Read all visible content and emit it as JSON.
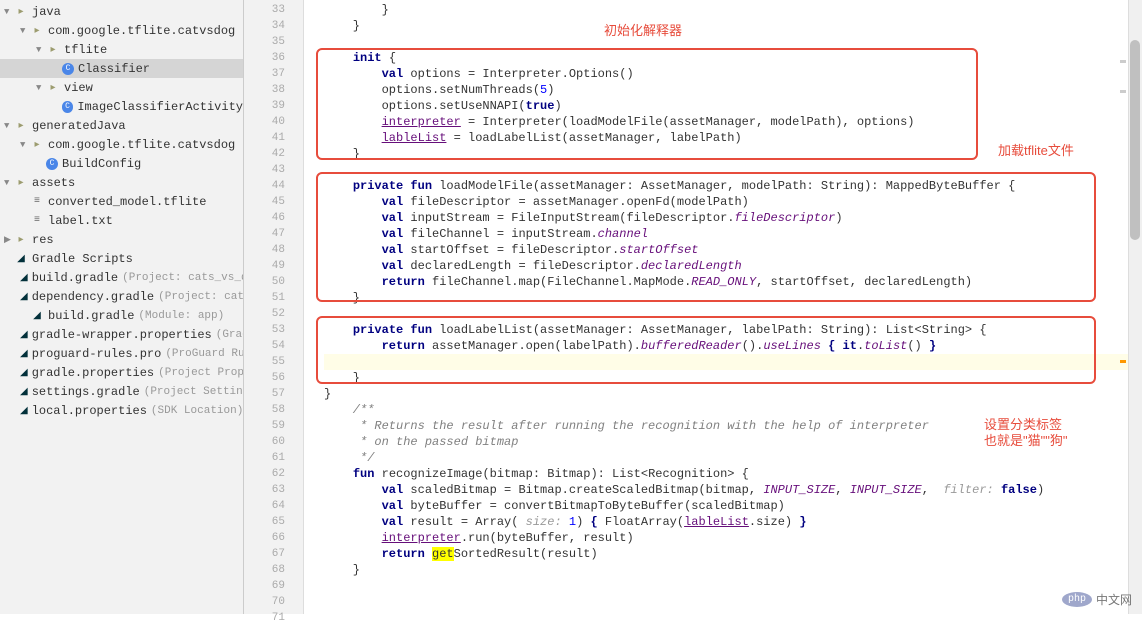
{
  "tree": [
    {
      "indent": 0,
      "arrow": "▼",
      "icon": "folder",
      "label": "java"
    },
    {
      "indent": 1,
      "arrow": "▼",
      "icon": "folder",
      "label": "com.google.tflite.catvsdog"
    },
    {
      "indent": 2,
      "arrow": "▼",
      "icon": "folder",
      "label": "tflite"
    },
    {
      "indent": 3,
      "arrow": "",
      "icon": "class",
      "label": "Classifier",
      "selected": true
    },
    {
      "indent": 2,
      "arrow": "▼",
      "icon": "folder",
      "label": "view"
    },
    {
      "indent": 3,
      "arrow": "",
      "icon": "class",
      "label": "ImageClassifierActivity"
    },
    {
      "indent": 0,
      "arrow": "▼",
      "icon": "folder",
      "label": "generatedJava"
    },
    {
      "indent": 1,
      "arrow": "▼",
      "icon": "folder",
      "label": "com.google.tflite.catvsdog"
    },
    {
      "indent": 2,
      "arrow": "",
      "icon": "class",
      "label": "BuildConfig"
    },
    {
      "indent": 0,
      "arrow": "▼",
      "icon": "folder",
      "label": "assets"
    },
    {
      "indent": 1,
      "arrow": "",
      "icon": "txt",
      "label": "converted_model.tflite"
    },
    {
      "indent": 1,
      "arrow": "",
      "icon": "txt",
      "label": "label.txt"
    },
    {
      "indent": 0,
      "arrow": "▶",
      "icon": "folder",
      "label": "res"
    },
    {
      "indent": 0,
      "arrow": "",
      "icon": "gradle",
      "label": "Gradle Scripts",
      "noindent": true
    },
    {
      "indent": 1,
      "arrow": "",
      "icon": "gradle",
      "label": "build.gradle",
      "sub": "(Project: cats_vs_dogs)"
    },
    {
      "indent": 1,
      "arrow": "",
      "icon": "gradle",
      "label": "dependency.gradle",
      "sub": "(Project: cats_vs_..."
    },
    {
      "indent": 1,
      "arrow": "",
      "icon": "gradle",
      "label": "build.gradle",
      "sub": "(Module: app)"
    },
    {
      "indent": 1,
      "arrow": "",
      "icon": "gradle",
      "label": "gradle-wrapper.properties",
      "sub": "(Gradle Ve"
    },
    {
      "indent": 1,
      "arrow": "",
      "icon": "gradle",
      "label": "proguard-rules.pro",
      "sub": "(ProGuard Rules f"
    },
    {
      "indent": 1,
      "arrow": "",
      "icon": "gradle",
      "label": "gradle.properties",
      "sub": "(Project Properties)"
    },
    {
      "indent": 1,
      "arrow": "",
      "icon": "gradle",
      "label": "settings.gradle",
      "sub": "(Project Settings)"
    },
    {
      "indent": 1,
      "arrow": "",
      "icon": "gradle",
      "label": "local.properties",
      "sub": "(SDK Location)"
    }
  ],
  "linestart": 33,
  "lineend": 71,
  "code": {
    "l33": "        }",
    "l34": "    }",
    "l35": "",
    "l37a": "val",
    "l37b": " options = Interpreter.Options()",
    "l38": "        options.setNumThreads(",
    "l38n": "5",
    "l38c": ")",
    "l39a": "        options.setUseNNAPI(",
    "l39b": "true",
    "l39c": ")",
    "l41a": "lableList",
    "l41b": " = loadLabelList(assetManager, labelPath)",
    "l42": "    }",
    "l49a": "val",
    "l49b": " declaredLength = fileDescriptor.",
    "l49c": "declaredLength",
    "l51": "    }",
    "l57": "}",
    "l58": "    /**",
    "l59": "     * Returns the result after running the recognition with the help of interpreter",
    "l60": "     * on the passed bitmap",
    "l61": "     */",
    "l66a": "interpreter",
    "l66b": ".run(byteBuffer, result)",
    "l68": "    }",
    "l69": ""
  },
  "annotations": {
    "a1": "初始化解释器",
    "a2": "加载tflite文件",
    "a3": "设置分类标签",
    "a3b": "也就是\"猫\"\"狗\""
  },
  "watermark": "中文网"
}
